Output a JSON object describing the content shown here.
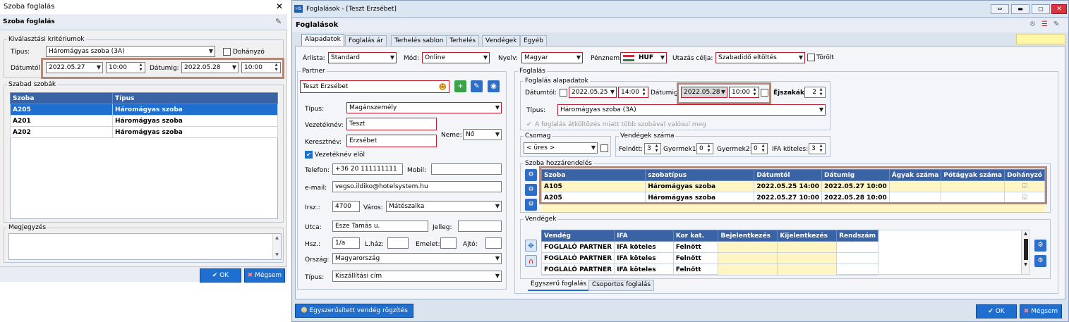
{
  "left": {
    "title": "Szoba foglalás",
    "close": "✕",
    "header": "Szoba foglalás",
    "criteria_title": "Kiválasztási kritériumok",
    "type_label": "Típus:",
    "type_value": "Háromágyas szoba (3A)",
    "smoker_label": "Dohányzó",
    "from_label": "Dátumtól:",
    "from_date": "2022.05.27",
    "from_time": "10:00",
    "to_label": "Dátumig:",
    "to_date": "2022.05.28",
    "to_time": "10:00",
    "free_title": "Szabad szobák",
    "col_room": "Szoba",
    "col_type": "Típus",
    "rows": [
      {
        "room": "A205",
        "type": "Háromágyas szoba"
      },
      {
        "room": "A201",
        "type": "Háromágyas szoba"
      },
      {
        "room": "A202",
        "type": "Háromágyas szoba"
      }
    ],
    "notes_title": "Megjegyzés",
    "ok": "OK",
    "cancel": "Mégsem"
  },
  "main": {
    "title": "Foglalások - [Teszt Erzsébet]",
    "header": "Foglalások",
    "tabs": [
      "Alapadatok",
      "Foglalás ár",
      "Terhelés sablon",
      "Terhelés",
      "Vendégek",
      "Egyéb"
    ],
    "top": {
      "arlista_label": "Árlista:",
      "arlista": "Standard",
      "mod_label": "Mód:",
      "mod": "Online",
      "nyelv_label": "Nyelv:",
      "nyelv": "Magyar",
      "penznem_label": "Pénznem:",
      "penznem": "HUF",
      "utazas_label": "Utazás célja:",
      "utazas": "Szabadidő eltöltés",
      "torolt_label": "Törölt"
    },
    "partner": {
      "title": "Partner",
      "name": "Teszt Erzsébet",
      "type_label": "Típus:",
      "type": "Magánszemély",
      "vez_label": "Vezetéknév:",
      "vez": "Teszt",
      "ker_label": "Keresztnév:",
      "ker": "Erzsébet",
      "neme_label": "Neme:",
      "neme": "Nő",
      "vez_elol": "Vezetéknév elöl",
      "tel_label": "Telefon:",
      "tel": "+36 20 111111111",
      "mobil_label": "Mobil:",
      "email_label": "e-mail:",
      "email": "vegso.ildiko@hotelsystem.hu",
      "irsz_label": "Irsz.:",
      "irsz": "4700",
      "varos_label": "Város:",
      "varos": "Mátészalka",
      "utca_label": "Utca:",
      "utca": "Esze Tamás u.",
      "jelleg_label": "Jelleg:",
      "hsz_label": "Hsz.:",
      "hsz": "1/a",
      "lhaz_label": "L.ház:",
      "emelet_label": "Emelet:",
      "ajto_label": "Ajtó:",
      "orszag_label": "Ország:",
      "orszag": "Magyarország",
      "tipus2_label": "Típus:",
      "tipus2": "Kiszállítási cím",
      "quick_btn": "Egyszerűsített vendég rögzítés"
    },
    "foglalas": {
      "title": "Foglalás",
      "alap_title": "Foglalás alapadatok",
      "from_label": "Dátumtól:",
      "from_date": "2022.05.25",
      "from_time": "14:00",
      "to_label": "Dátumig",
      "to_date": "2022.05.28",
      "to_time": "10:00",
      "nights_label": "Éjszakák:",
      "nights": "2",
      "type_label": "Típus:",
      "type": "Háromágyas szoba (3A)",
      "note": "A foglalás átköltözés miatt több szobával valósul meg",
      "csomag_title": "Csomag",
      "csomag": "< üres >",
      "vendegszam_title": "Vendégek száma",
      "felnott_label": "Felnőtt:",
      "felnott": "3",
      "gyermek1_label": "Gyermek1:",
      "gyermek1": "0",
      "gyermek2_label": "Gyermek2:",
      "gyermek2": "0",
      "ifa_label": "IFA köteles:",
      "ifa": "3",
      "szoba_title": "Szoba hozzárendelés",
      "room_cols": [
        "Szoba",
        "szobatípus",
        "Dátumtól",
        "Dátumig",
        "Ágyak száma",
        "Pótágyak száma",
        "Dohányzó"
      ],
      "room_rows": [
        {
          "szoba": "A105",
          "tipus": "Háromágyas szoba",
          "tol": "2022.05.25 14:00",
          "ig": "2022.05.27 10:00"
        },
        {
          "szoba": "A205",
          "tipus": "Háromágyas szoba",
          "tol": "2022.05.27 10:00",
          "ig": "2022.05.28 10:00"
        }
      ],
      "vendegek_title": "Vendégek",
      "guest_cols": [
        "Vendég",
        "IFA",
        "Kor kat.",
        "Bejelentkezés",
        "Kijelentkezés",
        "Rendszám"
      ],
      "guest_rows": [
        {
          "vendeg": "FOGLALÓ PARTNER",
          "ifa": "IFA köteles",
          "kor": "Felnőtt"
        },
        {
          "vendeg": "FOGLALÓ PARTNER",
          "ifa": "IFA köteles",
          "kor": "Felnőtt"
        },
        {
          "vendeg": "FOGLALÓ PARTNER",
          "ifa": "IFA köteles",
          "kor": "Felnőtt"
        }
      ],
      "subtab1": "Egyszerű foglalás",
      "subtab2": "Csoportos foglalás"
    },
    "ok": "OK",
    "cancel": "Mégsem"
  },
  "colors": {
    "accent": "#1e6fd0",
    "header_blue": "#3a63a5",
    "highlight": "#b0897a",
    "row_yellow": "#fff6c4"
  }
}
